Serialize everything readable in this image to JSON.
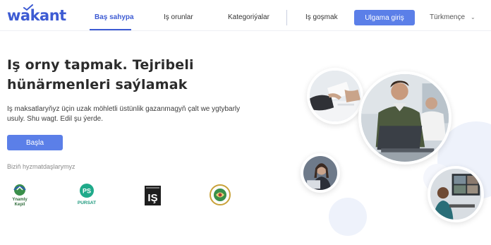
{
  "brand": {
    "name": "wakant",
    "color": "#3d5bd3"
  },
  "nav": {
    "home": "Baş sahypa",
    "jobs": "Iş orunlar",
    "categories": "Kategoriýalar",
    "post_job": "Iş goşmak",
    "employer_login": "Ulgama giriş",
    "language": "Türkmençe"
  },
  "hero": {
    "title_line1": "Iş orny tapmak. Tejribeli",
    "title_line2": "hünärmenleri saýlamak",
    "subtitle": "Iş maksatlaryňyz üçin uzak möhletli üstünlik gazanmagyň çalt we ygtybarly usuly. Shu wagt. Edil şu ýerde.",
    "start_button": "Başla"
  },
  "partners": {
    "label": "Biziň hyzmatdaşlarymyz",
    "items": [
      {
        "name": "Ynamly Kepil",
        "icon": "ynamly-kepil-logo"
      },
      {
        "name": "PURSAT",
        "icon": "pursat-logo"
      },
      {
        "name": "IŞ",
        "icon": "is-magazine-logo"
      },
      {
        "name": "partner-seal",
        "icon": "round-seal-logo"
      }
    ]
  },
  "colors": {
    "accent": "#5b7fe8",
    "primary_text": "#2b2b2b",
    "muted": "#8a8a8a",
    "deco_circle": "#eef2fb"
  }
}
